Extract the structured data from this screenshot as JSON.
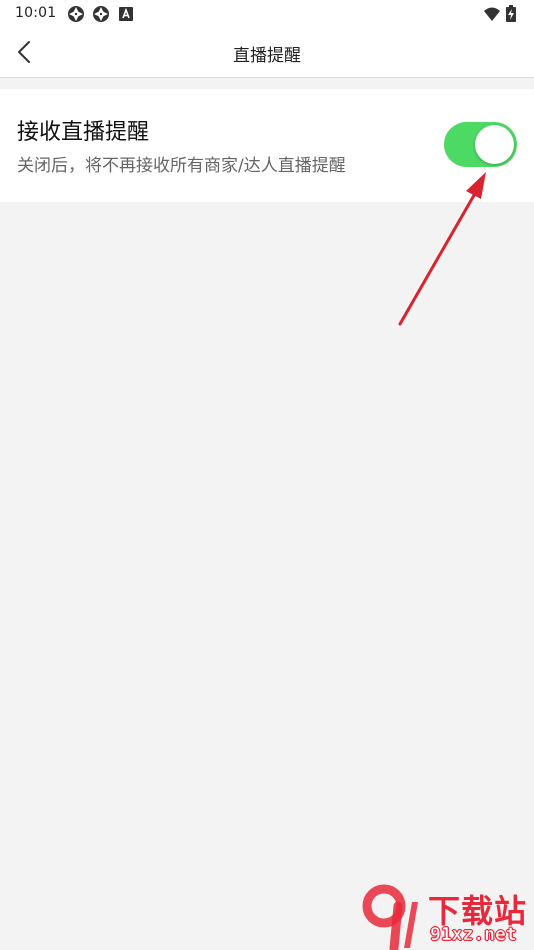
{
  "status_bar": {
    "time": "10:01",
    "icons": [
      "aperture-icon",
      "aperture-icon",
      "text-a-icon",
      "wifi-icon",
      "battery-charging-icon"
    ]
  },
  "header": {
    "back_icon": "chevron-left-icon",
    "title": "直播提醒"
  },
  "setting": {
    "title": "接收直播提醒",
    "description": "关闭后，将不再接收所有商家/达人直播提醒",
    "toggle_on": true,
    "toggle_color": "#4cd964"
  },
  "annotation": {
    "arrow_color": "#d9232e"
  },
  "watermark": {
    "text_cn": "下载站",
    "text_domain": "91xz.net",
    "logo_text": "9"
  }
}
